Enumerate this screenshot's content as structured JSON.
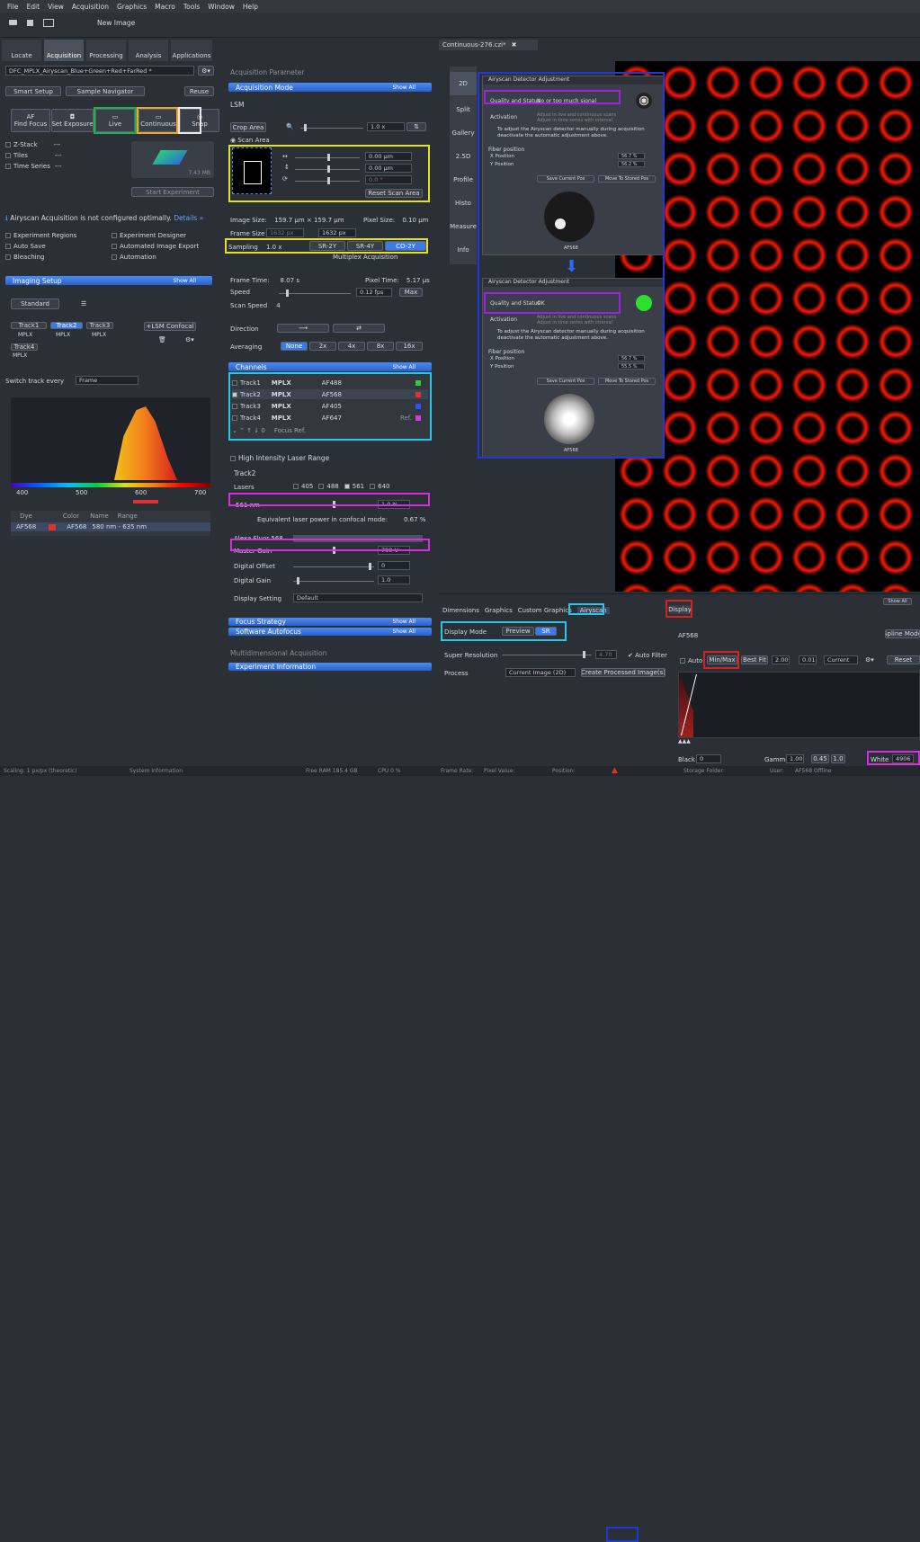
{
  "menu": [
    "File",
    "Edit",
    "View",
    "Acquisition",
    "Graphics",
    "Macro",
    "Tools",
    "Window",
    "Help"
  ],
  "toolbar": {
    "new_image": "New Image"
  },
  "left_tabs": [
    "Locate",
    "Acquisition",
    "Processing",
    "Analysis",
    "Applications"
  ],
  "experiment_name": "DFC_MPLX_Airyscan_Blue+Green+Red+FarRed *",
  "smart_setup": "Smart Setup",
  "sample_navigator": "Sample Navigator",
  "reuse": "Reuse",
  "acq_buttons": [
    "Find Focus",
    "Set Exposure",
    "Live",
    "Continuous",
    "Snap"
  ],
  "acq_button_prefix": "AF",
  "dims": [
    "Z-Stack",
    "Tiles",
    "Time Series"
  ],
  "dims_val": "---",
  "size_label": "7.43 MB",
  "start_experiment": "Start Experiment",
  "warning": {
    "text": "Airyscan Acquisition is not configured optimally.",
    "link": "Details »"
  },
  "tools_left": [
    "Experiment Regions",
    "Auto Save",
    "Bleaching"
  ],
  "tools_right": [
    "Experiment Designer",
    "Automated Image Export",
    "Automation"
  ],
  "imaging_setup": {
    "title": "Imaging Setup",
    "show_all": "Show All",
    "standard": "Standard",
    "tracks": [
      "Track1",
      "Track2",
      "Track3",
      "Track4"
    ],
    "mplx": "MPLX",
    "lsm_confocal": "+LSM Confocal",
    "switch_track": "Switch track every",
    "frame": "Frame",
    "spectrum_ticks": [
      "400",
      "500",
      "600",
      "700"
    ],
    "dye_headers": [
      "Dye",
      "Color",
      "Name",
      "Range"
    ],
    "dye_row": {
      "dye": "AF568",
      "name": "AF568",
      "range": "580 nm - 635 nm"
    }
  },
  "acq_param": {
    "header": "Acquisition Parameter",
    "mode_title": "Acquisition Mode",
    "show_all": "Show All",
    "lsm": "LSM",
    "crop_area": "Crop Area",
    "zoom": "1.0 x",
    "scan_area": "Scan Area",
    "offset_x": "0.00 µm",
    "offset_y": "0.00 µm",
    "rotation": "0.0 °",
    "reset_scan_area": "Reset Scan Area",
    "image_size_label": "Image Size:",
    "image_size": "159.7 µm × 159.7 µm",
    "pixel_size_label": "Pixel Size:",
    "pixel_size": "0.10 µm",
    "frame_size_label": "Frame Size",
    "frame_w": "1632 px",
    "frame_h": "1632 px",
    "sampling_label": "Sampling",
    "sampling_val": "1.0 x",
    "sampling_opts": [
      "SR-2Y",
      "SR-4Y",
      "CO-2Y"
    ],
    "multiplex": "Multiplex Acquisition",
    "frame_time_label": "Frame Time:",
    "frame_time": "8.07 s",
    "pixel_time_label": "Pixel Time:",
    "pixel_time": "5.17 µs",
    "speed_label": "Speed",
    "speed_val": "0.12 fps",
    "max": "Max",
    "scan_speed_label": "Scan Speed",
    "scan_speed": "4",
    "direction": "Direction",
    "averaging": "Averaging",
    "avg_opts": [
      "None",
      "2x",
      "4x",
      "8x",
      "16x"
    ]
  },
  "channels": {
    "title": "Channels",
    "show_all": "Show All",
    "rows": [
      {
        "track": "Track1",
        "mplx": "MPLX",
        "dye": "AF488",
        "color": "#2ecc40"
      },
      {
        "track": "Track2",
        "mplx": "MPLX",
        "dye": "AF568",
        "color": "#e03030"
      },
      {
        "track": "Track3",
        "mplx": "MPLX",
        "dye": "AF405",
        "color": "#3050ff"
      },
      {
        "track": "Track4",
        "mplx": "MPLX",
        "dye": "AF647",
        "color": "#d040d0",
        "ref": "Ref."
      }
    ],
    "focus_ref": "Focus Ref.",
    "high_intensity": "High Intensity Laser Range",
    "track2": "Track2",
    "lasers_label": "Lasers",
    "lasers": [
      "405",
      "488",
      "561",
      "640"
    ],
    "laser_line": "561 nm",
    "laser_val": "1.0 %",
    "equiv": "Equivalent laser power in confocal mode:",
    "equiv_val": "0.67 %",
    "alexa": "Alexa Fluor 568",
    "master_gain": "Master Gain",
    "master_gain_val": "790 V",
    "digital_offset": "Digital Offset",
    "digital_offset_val": "0",
    "digital_gain": "Digital Gain",
    "digital_gain_val": "1.0",
    "display_setting": "Display Setting",
    "display_setting_val": "Default"
  },
  "sections": {
    "focus_strategy": "Focus Strategy",
    "software_autofocus": "Software Autofocus",
    "multidim": "Multidimensional Acquisition",
    "experiment_info": "Experiment Information",
    "show_all": "Show All"
  },
  "image_tab": "Continuous-276.czi*",
  "view_tabs": [
    "2D",
    "Split",
    "Gallery",
    "2.5D",
    "Profile",
    "Histo",
    "Measure",
    "Info"
  ],
  "airyscan_top": {
    "title": "Airyscan Detector Adjustment",
    "quality_label": "Quality and Status",
    "quality": "No or too much signal",
    "activation": "Activation",
    "act1": "Adjust in live and continuous scans",
    "act2": "Adjust in time series with interval",
    "note": "To adjust the Airyscan detector manually during acquisition deactivate the automatic adjustment above.",
    "fiber": "Fiber position",
    "xpos": "X Position",
    "ypos": "Y Position",
    "xval": "56.7 %",
    "yval": "56.2 %",
    "save": "Save Current Pos",
    "move": "Move To Stored Pos",
    "label": "AF568"
  },
  "airyscan_bot": {
    "title": "Airyscan Detector Adjustment",
    "quality_label": "Quality and Status",
    "quality": "OK",
    "xval": "56.7 %",
    "yval": "55.5 %"
  },
  "bottom_tabs": [
    "Dimensions",
    "Graphics",
    "Custom Graphics",
    "Airyscan"
  ],
  "display_tab": "Display",
  "airyscan_panel": {
    "display_mode": "Display Mode",
    "preview": "Preview",
    "sr": "SR",
    "super_res": "Super Resolution",
    "sr_val": "4.70",
    "auto_filter": "Auto Filter",
    "process": "Process",
    "current_image": "Current Image (2D)",
    "create_processed": "Create Processed Image(s)"
  },
  "display_panel": {
    "channel": "AF568",
    "spline": "Spline Mode",
    "auto": "Auto",
    "minmax": "Min/Max",
    "bestfit": "Best Fit",
    "v1": "2.00",
    "v2": "0.01",
    "current": "Current",
    "reset": "Reset",
    "black_label": "Black",
    "black": "0",
    "gamma_label": "Gamma",
    "gamma": "1.00",
    "gamma2": "0.45",
    "gamma3": "1.0",
    "white_label": "White",
    "white": "4906",
    "show_all": "Show All"
  },
  "status": {
    "scaling": "Scaling: 1 px/px (theoretic)",
    "system_info": "System Information",
    "free_ram": "Free RAM 185.4 GB",
    "cpu": "CPU 0 %",
    "frame_rate": "Frame Rate:",
    "pixel_value": "Pixel Value:",
    "position": "Position:",
    "storage": "Storage Folder:",
    "user": "User:",
    "afs": "AF568 Offline"
  },
  "colors": {
    "accent": "#3b7be8",
    "highlight_green": "#22b24c",
    "highlight_orange": "#f2a32b",
    "highlight_yellow": "#e6e21a",
    "highlight_cyan": "#2ac6e8",
    "highlight_magenta": "#d82ee0",
    "highlight_blue": "#2336d8",
    "highlight_red": "#d82020"
  }
}
